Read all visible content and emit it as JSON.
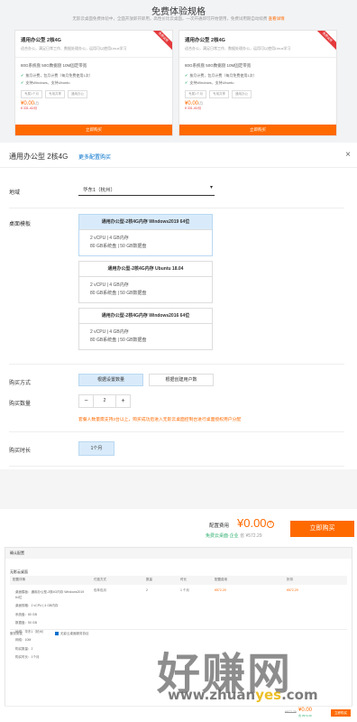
{
  "banner": {
    "title": "免费体验规格",
    "subtitle": "无影云桌面免费体验中，全面开放即开即用，高性价比云桌面，一次开通即可开始使用，免费试用期自动续费",
    "subtitle_link": "查看详情",
    "cards": [
      {
        "title": "通用办公型 2核4G",
        "subtitle": "适合办公，满足日常工作、数据处理办公，运用可以使用Linux学习",
        "ribbon": "免费试用",
        "spec": "80G系统盘 50G数据盘 10M固定带宽",
        "features": [
          "按月计费，包月计费（每月免费使用1次）",
          "支持Windows、支持Ubuntu"
        ],
        "tags": [
          "专属1个月",
          "专用共享",
          "通用办公"
        ],
        "price": "¥0.00",
        "price_unit": "/月",
        "orig": "¥ 331.40/月",
        "button": "立即购买"
      },
      {
        "title": "通用办公型 2核4G",
        "subtitle": "适合办公，满足日常工作、数据处理办公，运用可以使用Linux学习",
        "ribbon": "免费试用",
        "spec": "80G系统盘 50G数据盘 10M固定带宽",
        "features": [
          "按月计费，包月计费（每月免费使用1次）",
          "支持Windows、支持Ubuntu"
        ],
        "tags": [
          "专属1个月",
          "专用共享",
          "通用办公"
        ],
        "price": "¥0.00",
        "price_unit": "/月",
        "orig": "¥ 331.40/月",
        "button": "立即购买"
      }
    ]
  },
  "dialog": {
    "title": "通用办公型 2核4G",
    "more_link": "更多配置购买",
    "close": "×",
    "region_label": "地域",
    "region_value": "华东1（杭州）",
    "template_label": "桌面模板",
    "templates": [
      {
        "title": "通用办公型-2核4G内存 Windows2019 64位",
        "line1": "2 vCPU | 4 GB内存",
        "line2": "80 GB系统盘 | 50 GB数据盘"
      },
      {
        "title": "通用办公型-2核4G内存 Ubuntu 18.04",
        "line1": "2 vCPU | 4 GB内存",
        "line2": "80 GB系统盘 | 50 GB数据盘"
      },
      {
        "title": "通用办公型-2核4G内存 Windows2016 64位",
        "line1": "2 vCPU | 4 GB内存",
        "line2": "80 GB系统盘 | 50 GB数据盘"
      }
    ],
    "purchase_method_label": "购买方式",
    "purchase_options": [
      "根据设置数量",
      "根据创建用户数"
    ],
    "quantity_label": "购买数量",
    "quantity_value": "2",
    "quantity_warning": "套餐人数量需支持2台以上，购买成功后进入无影云桌面控制台进行桌面授权用户分配",
    "duration_label": "购买时长",
    "duration_value": "1个月"
  },
  "price_bar": {
    "label": "配置费用",
    "value": "¥0.00",
    "help": "?",
    "green_line": "免费云桌面·企业",
    "green_save": "省 ¥572.29",
    "buy_button": "立即购买"
  },
  "order": {
    "header": "确认配置",
    "section": "无影云桌面",
    "columns": [
      "配置详情",
      "付费方式",
      "数量",
      "时长",
      "配置费用",
      "折扣"
    ],
    "row": {
      "detail": [
        "桌面模板：通用办公型-2核4G内存 Windows2019 64位",
        "桌面规格：2 vCPU | 4 GB内存",
        "系统盘：80 GB",
        "数据盘：50 GB",
        "地域：华东1（杭州）",
        "网络：10M",
        "购买数量：2",
        "购买时长：1个月"
      ],
      "payment": "包年包月",
      "qty": "2",
      "duration": "1 个月",
      "fee": "¥572.29",
      "discount": "¥572.29"
    },
    "service_label": "服务协议",
    "agree_text": "无影云桌面服务协议"
  },
  "watermark": {
    "text": "好赚网",
    "url_a": "www.zhuan",
    "url_b": "yes",
    "url_c": ".com"
  },
  "footer": {
    "orig": "¥572.29",
    "price": "¥0.00",
    "save": "省 ¥572.29",
    "button": "立即购买"
  }
}
